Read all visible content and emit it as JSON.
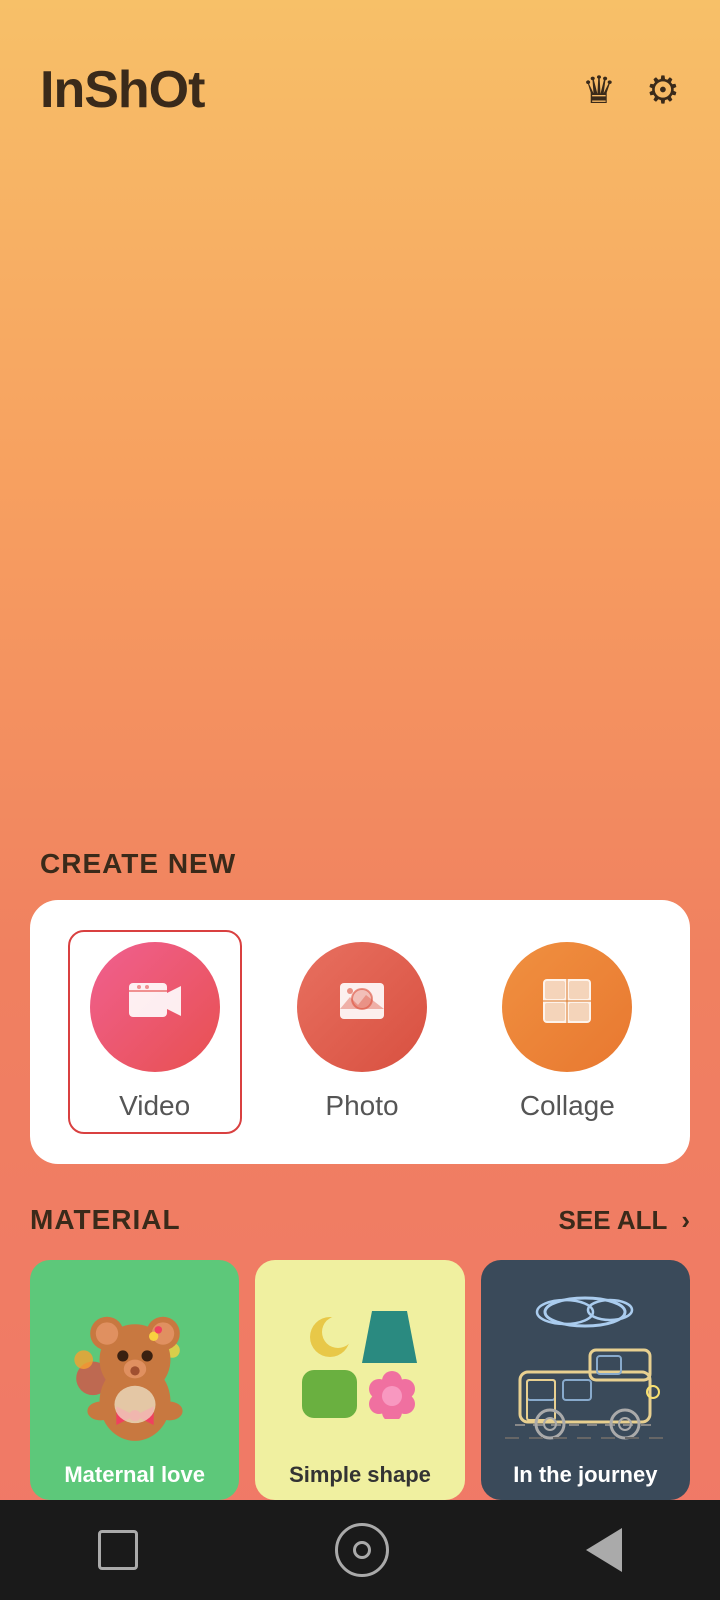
{
  "app": {
    "title": "InShOt"
  },
  "header": {
    "crown_icon": "♛",
    "settings_icon": "⚙"
  },
  "create_new": {
    "section_label": "CREATE NEW",
    "items": [
      {
        "id": "video",
        "label": "Video",
        "selected": true
      },
      {
        "id": "photo",
        "label": "Photo",
        "selected": false
      },
      {
        "id": "collage",
        "label": "Collage",
        "selected": false
      }
    ]
  },
  "material": {
    "section_label": "MATERIAL",
    "see_all_label": "SEE ALL",
    "see_all_chevron": "›",
    "cards": [
      {
        "id": "maternal-love",
        "label": "Maternal love"
      },
      {
        "id": "simple-shape",
        "label": "Simple shape"
      },
      {
        "id": "in-the-journey",
        "label": "In the journey"
      }
    ]
  },
  "bottom_nav": {
    "items": [
      "square",
      "circle",
      "triangle"
    ]
  }
}
